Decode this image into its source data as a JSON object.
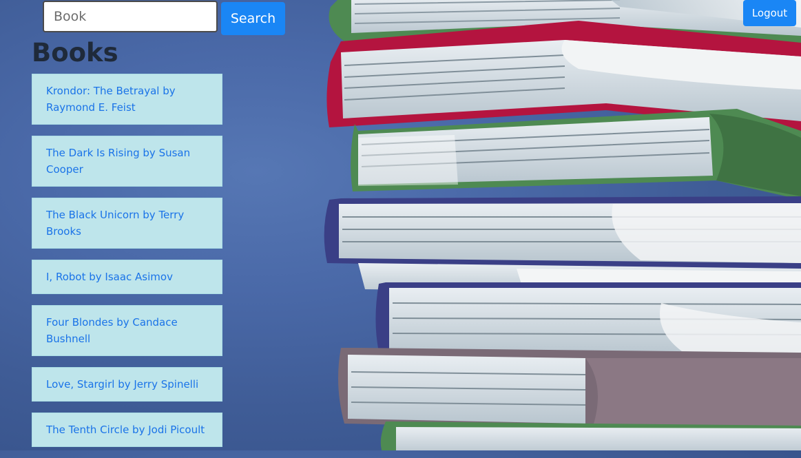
{
  "search": {
    "placeholder": "Book",
    "value": "",
    "button_label": "Search"
  },
  "header": {
    "logout_label": "Logout"
  },
  "main": {
    "title": "Books",
    "books": [
      {
        "label": "Krondor: The Betrayal by Raymond E. Feist"
      },
      {
        "label": "The Dark Is Rising by Susan Cooper"
      },
      {
        "label": "The Black Unicorn by Terry Brooks"
      },
      {
        "label": "I, Robot by Isaac Asimov"
      },
      {
        "label": "Four Blondes by Candace Bushnell"
      },
      {
        "label": "Love, Stargirl by Jerry Spinelli"
      },
      {
        "label": "The Tenth Circle by Jodi Picoult"
      }
    ]
  },
  "colors": {
    "accent": "#1a86f5",
    "list_item_bg": "#bee5eb",
    "list_item_text": "#1a73e8",
    "page_background": "#4a69a8"
  },
  "background": {
    "image": "book-stack-illustration"
  }
}
